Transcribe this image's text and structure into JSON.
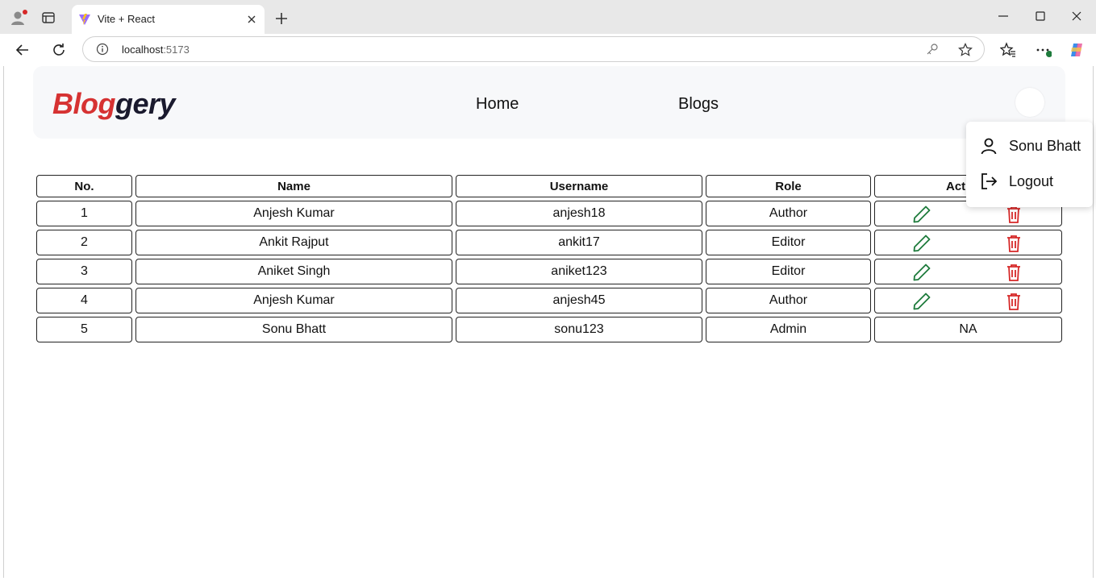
{
  "browser": {
    "tab_title": "Vite + React",
    "url_host": "localhost",
    "url_port": ":5173"
  },
  "app": {
    "logo_part1": "Blog",
    "logo_part2": "gery",
    "nav": [
      {
        "label": "Home"
      },
      {
        "label": "Blogs"
      }
    ]
  },
  "table": {
    "headers": [
      "No.",
      "Name",
      "Username",
      "Role",
      "Actions"
    ],
    "rows": [
      {
        "no": "1",
        "name": "Anjesh Kumar",
        "username": "anjesh18",
        "role": "Author",
        "actions": true
      },
      {
        "no": "2",
        "name": "Ankit Rajput",
        "username": "ankit17",
        "role": "Editor",
        "actions": true
      },
      {
        "no": "3",
        "name": "Aniket Singh",
        "username": "aniket123",
        "role": "Editor",
        "actions": true
      },
      {
        "no": "4",
        "name": "Anjesh Kumar",
        "username": "anjesh45",
        "role": "Author",
        "actions": true
      },
      {
        "no": "5",
        "name": "Sonu Bhatt",
        "username": "sonu123",
        "role": "Admin",
        "actions": false,
        "actions_text": "NA"
      }
    ]
  },
  "dropdown": {
    "user_label": "Sonu Bhatt",
    "logout_label": "Logout"
  },
  "colors": {
    "logo_red": "#d63232",
    "edit_green": "#1e7b3c",
    "delete_red": "#d62828"
  }
}
